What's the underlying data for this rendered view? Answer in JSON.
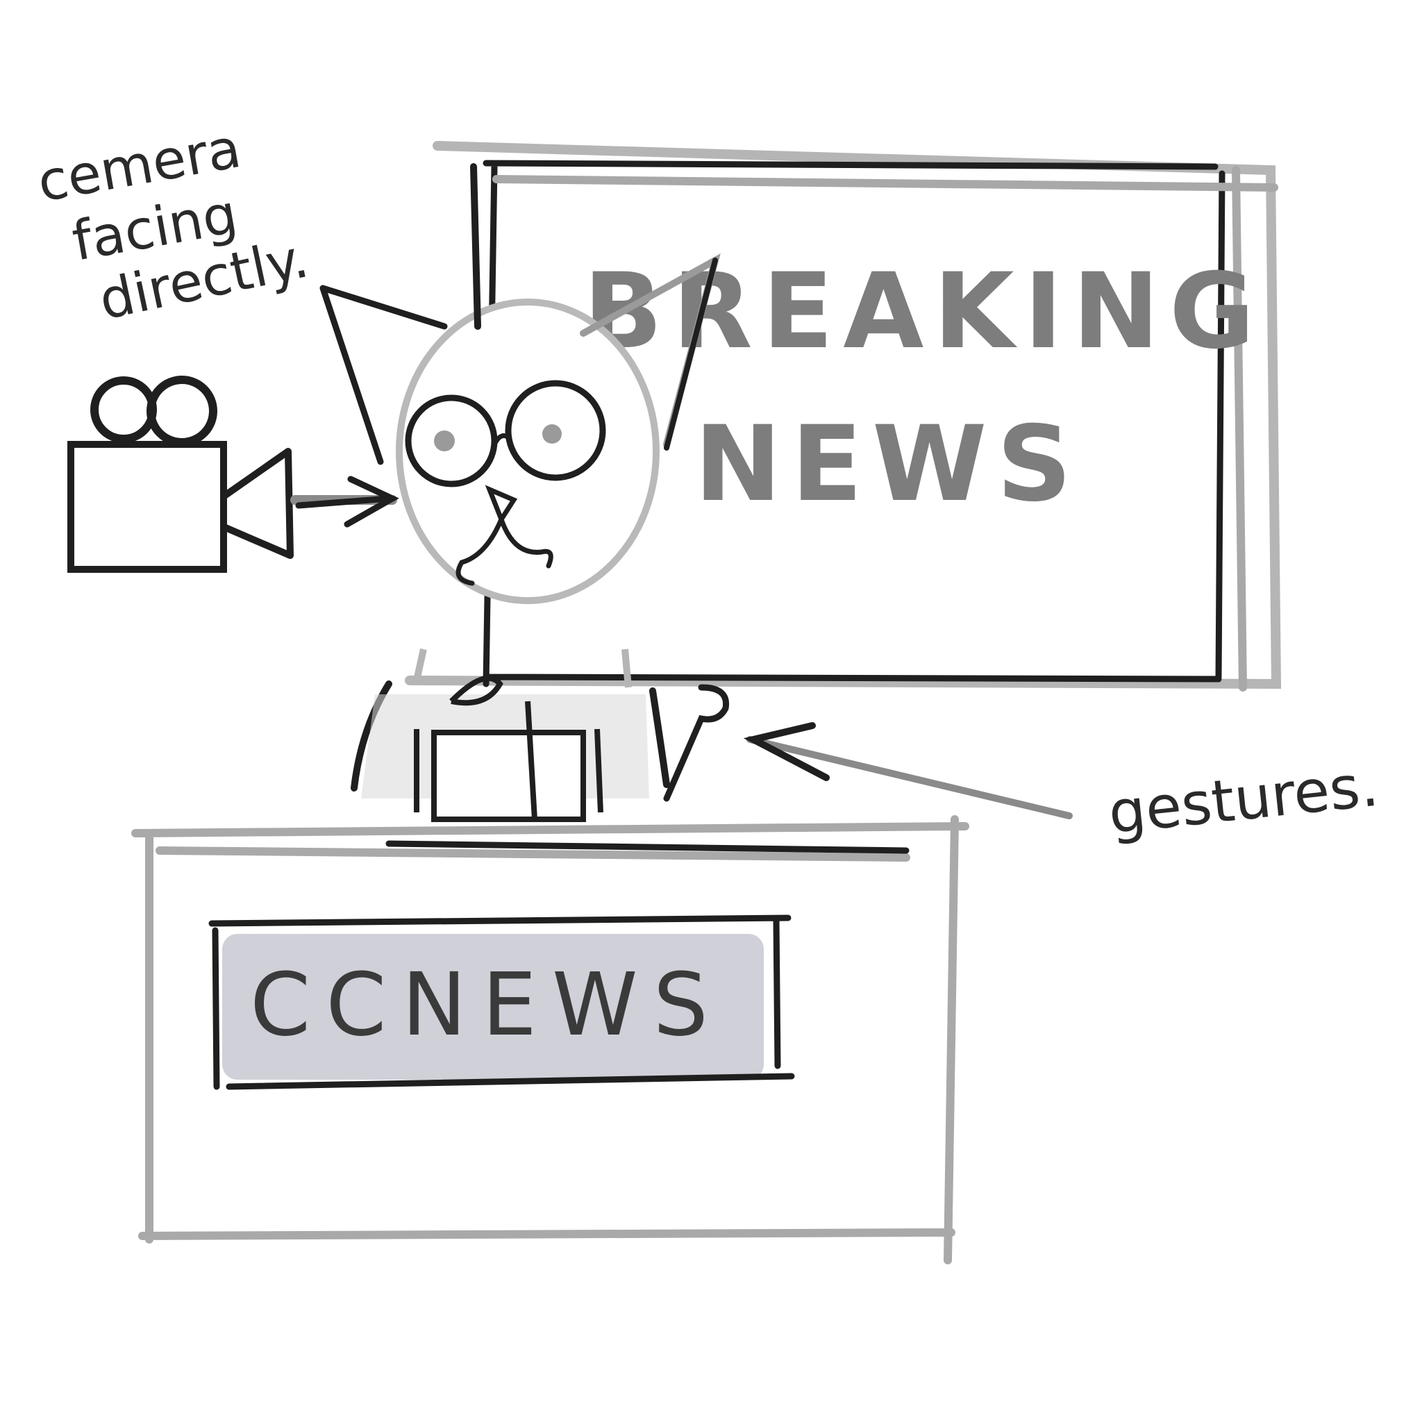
{
  "annotations": {
    "camera_note_lines": [
      "cemera",
      "facing",
      "directly."
    ],
    "gestures_note": "gestures."
  },
  "screen": {
    "headline_line1": "BREAKING",
    "headline_line2": "NEWS"
  },
  "desk": {
    "nameplate": "CCNEWS"
  },
  "colors": {
    "ink_dark": "#1e1e1e",
    "ink_light": "#9a9a9a",
    "nameplate_fill": "#cfd0d8"
  },
  "icons": [
    "camera-icon",
    "arrow-icon"
  ]
}
